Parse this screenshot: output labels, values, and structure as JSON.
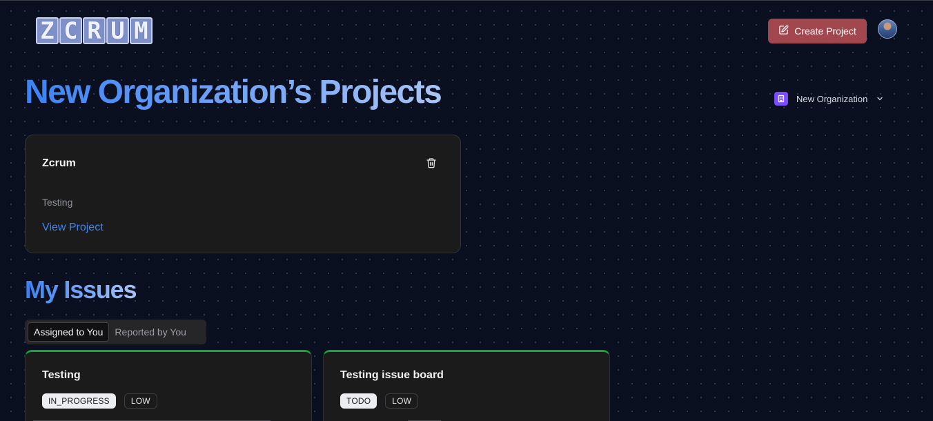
{
  "header": {
    "logo_letters": [
      "Z",
      "C",
      "R",
      "U",
      "M"
    ],
    "create_button_label": "Create Project",
    "avatar_icon": "user-avatar-icon"
  },
  "page": {
    "title": "New Organization’s Projects",
    "organization_switcher": {
      "label": "New Organization",
      "badge_icon": "building-icon",
      "chevron_icon": "chevron-down-icon",
      "badge_color": "#7c4dff"
    }
  },
  "projects": [
    {
      "name": "Zcrum",
      "description": "Testing",
      "link_label": "View Project",
      "delete_icon": "trash-icon"
    }
  ],
  "my_issues": {
    "title": "My Issues",
    "tabs": [
      {
        "label": "Assigned to You",
        "active": true
      },
      {
        "label": "Reported by You",
        "active": false
      }
    ],
    "issues": [
      {
        "title": "Testing",
        "status": "IN_PROGRESS",
        "priority": "LOW"
      },
      {
        "title": "Testing issue board",
        "status": "TODO",
        "priority": "LOW"
      }
    ]
  },
  "colors": {
    "background": "#0b1020",
    "accent_blue": "#3b82f6",
    "create_button": "#a3474f",
    "issue_border": "#18a33a"
  }
}
